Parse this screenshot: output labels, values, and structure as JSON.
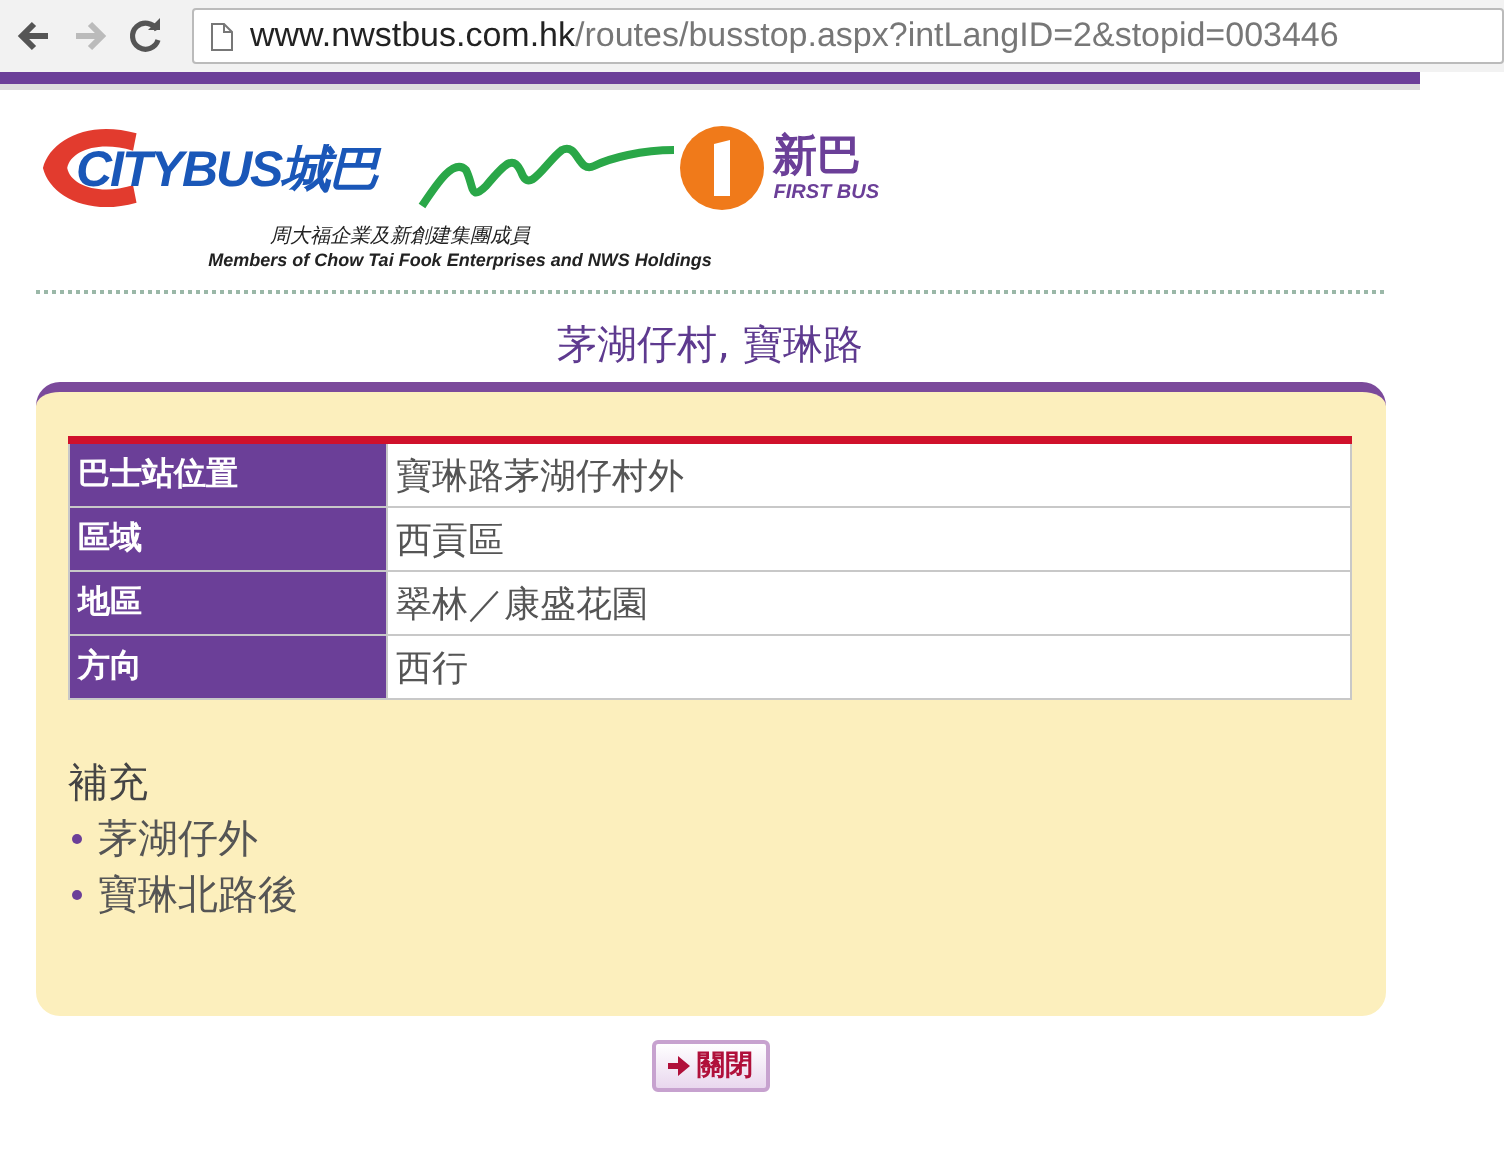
{
  "browser": {
    "url_host": "www.nwstbus.com.hk",
    "url_path": "/routes/busstop.aspx?intLangID=2&stopid=003446"
  },
  "header": {
    "logo_left": {
      "text": "CITYBUS城巴"
    },
    "logo_right": {
      "text_cn": "新巴",
      "text_en": "FIRST BUS"
    },
    "caption_cn": "周大福企業及新創建集團成員",
    "caption_en": "Members of Chow Tai Fook Enterprises and NWS Holdings"
  },
  "title": "茅湖仔村, 寶琳路",
  "details": [
    {
      "label": "巴士站位置",
      "value": "寶琳路茅湖仔村外"
    },
    {
      "label": "區域",
      "value": "西貢區"
    },
    {
      "label": "地區",
      "value": "翠林／康盛花園"
    },
    {
      "label": "方向",
      "value": "西行"
    }
  ],
  "supplement": {
    "heading": "補充",
    "items": [
      "茅湖仔外",
      "寶琳北路後"
    ]
  },
  "close_button": {
    "label": "關閉"
  }
}
